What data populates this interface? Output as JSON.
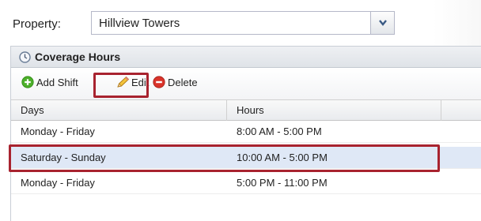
{
  "property": {
    "label": "Property:",
    "selected_value": "Hillview Towers"
  },
  "coverage": {
    "title": "Coverage Hours"
  },
  "toolbar": {
    "add_label": "Add Shift",
    "edit_label": "Edit",
    "delete_label": "Delete"
  },
  "grid": {
    "columns": [
      "Days",
      "Hours"
    ],
    "rows": [
      {
        "days": "Monday - Friday",
        "hours": "8:00 AM - 5:00 PM",
        "selected": false
      },
      {
        "days": "Saturday - Sunday",
        "hours": "10:00 AM - 5:00 PM",
        "selected": true
      },
      {
        "days": "Monday - Friday",
        "hours": "5:00 PM - 11:00 PM",
        "selected": false
      }
    ]
  },
  "colors": {
    "highlight_border": "#a8232f",
    "selected_row": "#dfe8f6",
    "add_icon": "#4caf2a",
    "delete_icon": "#d9342b"
  }
}
